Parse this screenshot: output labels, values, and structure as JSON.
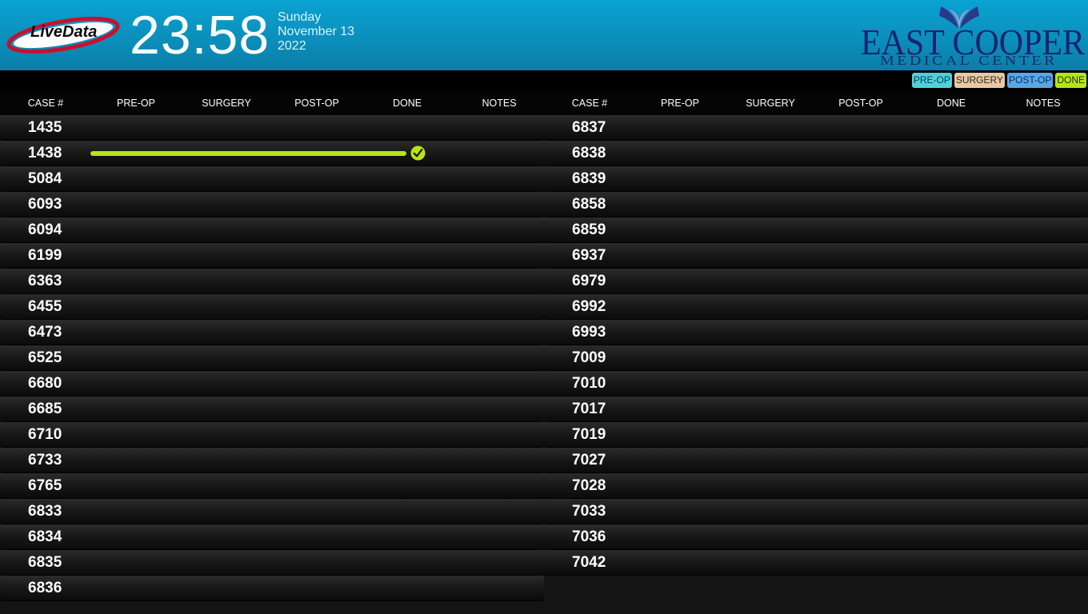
{
  "header": {
    "brand": "LiveData",
    "time": "23:58",
    "day": "Sunday",
    "date": "November 13",
    "year": "2022",
    "hospital_line1": "EAST COOPER",
    "hospital_line2": "MEDICAL CENTER"
  },
  "legend": {
    "preop": "PRE-OP",
    "surgery": "SURGERY",
    "postop": "POST-OP",
    "done": "DONE"
  },
  "colors": {
    "preop": "#4fd1d7",
    "surgery": "#e9c8a4",
    "postop": "#5aa7e6",
    "done": "#b6e516"
  },
  "columns": {
    "case": "CASE #",
    "preop": "PRE-OP",
    "surgery": "SURGERY",
    "postop": "POST-OP",
    "done": "DONE",
    "notes": "NOTES"
  },
  "left_cases": [
    {
      "case": "1435",
      "progress": 0,
      "done": false
    },
    {
      "case": "1438",
      "progress": 1,
      "done": true
    },
    {
      "case": "5084",
      "progress": 0,
      "done": false
    },
    {
      "case": "6093",
      "progress": 0,
      "done": false
    },
    {
      "case": "6094",
      "progress": 0,
      "done": false
    },
    {
      "case": "6199",
      "progress": 0,
      "done": false
    },
    {
      "case": "6363",
      "progress": 0,
      "done": false
    },
    {
      "case": "6455",
      "progress": 0,
      "done": false
    },
    {
      "case": "6473",
      "progress": 0,
      "done": false
    },
    {
      "case": "6525",
      "progress": 0,
      "done": false
    },
    {
      "case": "6680",
      "progress": 0,
      "done": false
    },
    {
      "case": "6685",
      "progress": 0,
      "done": false
    },
    {
      "case": "6710",
      "progress": 0,
      "done": false
    },
    {
      "case": "6733",
      "progress": 0,
      "done": false
    },
    {
      "case": "6765",
      "progress": 0,
      "done": false
    },
    {
      "case": "6833",
      "progress": 0,
      "done": false
    },
    {
      "case": "6834",
      "progress": 0,
      "done": false
    },
    {
      "case": "6835",
      "progress": 0,
      "done": false
    },
    {
      "case": "6836",
      "progress": 0,
      "done": false
    }
  ],
  "right_cases": [
    {
      "case": "6837",
      "progress": 0,
      "done": false
    },
    {
      "case": "6838",
      "progress": 0,
      "done": false
    },
    {
      "case": "6839",
      "progress": 0,
      "done": false
    },
    {
      "case": "6858",
      "progress": 0,
      "done": false
    },
    {
      "case": "6859",
      "progress": 0,
      "done": false
    },
    {
      "case": "6937",
      "progress": 0,
      "done": false
    },
    {
      "case": "6979",
      "progress": 0,
      "done": false
    },
    {
      "case": "6992",
      "progress": 0,
      "done": false
    },
    {
      "case": "6993",
      "progress": 0,
      "done": false
    },
    {
      "case": "7009",
      "progress": 0,
      "done": false
    },
    {
      "case": "7010",
      "progress": 0,
      "done": false
    },
    {
      "case": "7017",
      "progress": 0,
      "done": false
    },
    {
      "case": "7019",
      "progress": 0,
      "done": false
    },
    {
      "case": "7027",
      "progress": 0,
      "done": false
    },
    {
      "case": "7028",
      "progress": 0,
      "done": false
    },
    {
      "case": "7033",
      "progress": 0,
      "done": false
    },
    {
      "case": "7036",
      "progress": 0,
      "done": false
    },
    {
      "case": "7042",
      "progress": 0,
      "done": false
    }
  ]
}
